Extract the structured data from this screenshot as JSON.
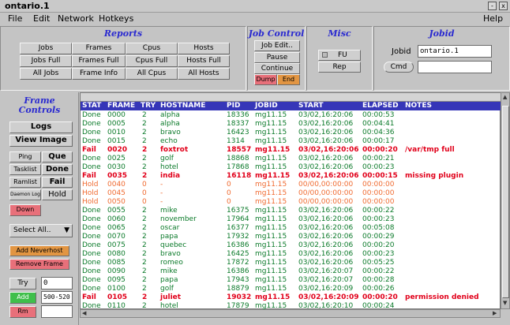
{
  "window": {
    "title": "ontario.1",
    "minimize_glyph": "-",
    "close_glyph": "x"
  },
  "menu": {
    "file": "File",
    "edit": "Edit",
    "network": "Network",
    "hotkeys": "Hotkeys",
    "help": "Help"
  },
  "reports": {
    "title": "Reports",
    "buttons": [
      "Jobs",
      "Frames",
      "Cpus",
      "Hosts",
      "Jobs Full",
      "Frames Full",
      "Cpus Full",
      "Hosts Full",
      "All Jobs",
      "Frame Info",
      "All Cpus",
      "All Hosts"
    ]
  },
  "job_control": {
    "title": "Job Control",
    "job_edit": "Job Edit..",
    "pause": "Pause",
    "continue": "Continue",
    "dump": "Dump",
    "end": "End"
  },
  "misc": {
    "title": "Misc",
    "fu": "FU",
    "rep": "Rep"
  },
  "jobid": {
    "title": "Jobid",
    "label": "Jobid",
    "value": "ontario.1",
    "cmd": "Cmd",
    "cmd_value": ""
  },
  "frame_controls": {
    "title_line1": "Frame",
    "title_line2": "Controls",
    "logs": "Logs",
    "view_image": "View Image",
    "ping": "Ping",
    "que": "Que",
    "tasklist": "Tasklist",
    "done": "Done",
    "ramlist": "Ramlist",
    "fail": "Fail",
    "daemon_log": "Daemon Log",
    "hold": "Hold",
    "down": "Down",
    "select": "Select All..",
    "add_neverhost": "Add Neverhost",
    "remove_frame": "Remove Frame",
    "try": "Try",
    "try_value": "0",
    "add": "Add",
    "add_value": "500-520",
    "rm": "Rm",
    "rm_value": ""
  },
  "table": {
    "columns": [
      "STAT",
      "FRAME",
      "TRY",
      "HOSTNAME",
      "PID",
      "JOBID",
      "START",
      "ELAPSED",
      "NOTES"
    ],
    "rows": [
      {
        "stat": "Done",
        "frame": "0000",
        "try": "2",
        "host": "alpha",
        "pid": "18336",
        "jobid": "mg11.15",
        "start": "03/02,16:20:06",
        "elapsed": "00:00:53",
        "notes": ""
      },
      {
        "stat": "Done",
        "frame": "0005",
        "try": "2",
        "host": "alpha",
        "pid": "18337",
        "jobid": "mg11.15",
        "start": "03/02,16:20:06",
        "elapsed": "00:04:41",
        "notes": ""
      },
      {
        "stat": "Done",
        "frame": "0010",
        "try": "2",
        "host": "bravo",
        "pid": "16423",
        "jobid": "mg11.15",
        "start": "03/02,16:20:06",
        "elapsed": "00:04:36",
        "notes": ""
      },
      {
        "stat": "Done",
        "frame": "0015",
        "try": "2",
        "host": "echo",
        "pid": "1314",
        "jobid": "mg11.15",
        "start": "03/02,16:20:06",
        "elapsed": "00:00:17",
        "notes": ""
      },
      {
        "stat": "Fail",
        "frame": "0020",
        "try": "2",
        "host": "foxtrot",
        "pid": "18557",
        "jobid": "mg11.15",
        "start": "03/02,16:20:06",
        "elapsed": "00:00:20",
        "notes": "/var/tmp full"
      },
      {
        "stat": "Done",
        "frame": "0025",
        "try": "2",
        "host": "golf",
        "pid": "18868",
        "jobid": "mg11.15",
        "start": "03/02,16:20:06",
        "elapsed": "00:00:21",
        "notes": ""
      },
      {
        "stat": "Done",
        "frame": "0030",
        "try": "2",
        "host": "hotel",
        "pid": "17868",
        "jobid": "mg11.15",
        "start": "03/02,16:20:06",
        "elapsed": "00:00:23",
        "notes": ""
      },
      {
        "stat": "Fail",
        "frame": "0035",
        "try": "2",
        "host": "india",
        "pid": "16118",
        "jobid": "mg11.15",
        "start": "03/02,16:20:06",
        "elapsed": "00:00:15",
        "notes": "missing plugin"
      },
      {
        "stat": "Hold",
        "frame": "0040",
        "try": "0",
        "host": "-",
        "pid": "0",
        "jobid": "mg11.15",
        "start": "00/00,00:00:00",
        "elapsed": "00:00:00",
        "notes": ""
      },
      {
        "stat": "Hold",
        "frame": "0045",
        "try": "0",
        "host": "-",
        "pid": "0",
        "jobid": "mg11.15",
        "start": "00/00,00:00:00",
        "elapsed": "00:00:00",
        "notes": ""
      },
      {
        "stat": "Hold",
        "frame": "0050",
        "try": "0",
        "host": "-",
        "pid": "0",
        "jobid": "mg11.15",
        "start": "00/00,00:00:00",
        "elapsed": "00:00:00",
        "notes": ""
      },
      {
        "stat": "Done",
        "frame": "0055",
        "try": "2",
        "host": "mike",
        "pid": "16375",
        "jobid": "mg11.15",
        "start": "03/02,16:20:06",
        "elapsed": "00:00:22",
        "notes": ""
      },
      {
        "stat": "Done",
        "frame": "0060",
        "try": "2",
        "host": "november",
        "pid": "17964",
        "jobid": "mg11.15",
        "start": "03/02,16:20:06",
        "elapsed": "00:00:23",
        "notes": ""
      },
      {
        "stat": "Done",
        "frame": "0065",
        "try": "2",
        "host": "oscar",
        "pid": "16377",
        "jobid": "mg11.15",
        "start": "03/02,16:20:06",
        "elapsed": "00:05:08",
        "notes": ""
      },
      {
        "stat": "Done",
        "frame": "0070",
        "try": "2",
        "host": "papa",
        "pid": "17932",
        "jobid": "mg11.15",
        "start": "03/02,16:20:06",
        "elapsed": "00:00:29",
        "notes": ""
      },
      {
        "stat": "Done",
        "frame": "0075",
        "try": "2",
        "host": "quebec",
        "pid": "16386",
        "jobid": "mg11.15",
        "start": "03/02,16:20:06",
        "elapsed": "00:00:20",
        "notes": ""
      },
      {
        "stat": "Done",
        "frame": "0080",
        "try": "2",
        "host": "bravo",
        "pid": "16425",
        "jobid": "mg11.15",
        "start": "03/02,16:20:06",
        "elapsed": "00:00:23",
        "notes": ""
      },
      {
        "stat": "Done",
        "frame": "0085",
        "try": "2",
        "host": "romeo",
        "pid": "17872",
        "jobid": "mg11.15",
        "start": "03/02,16:20:06",
        "elapsed": "00:05:25",
        "notes": ""
      },
      {
        "stat": "Done",
        "frame": "0090",
        "try": "2",
        "host": "mike",
        "pid": "16386",
        "jobid": "mg11.15",
        "start": "03/02,16:20:07",
        "elapsed": "00:00:22",
        "notes": ""
      },
      {
        "stat": "Done",
        "frame": "0095",
        "try": "2",
        "host": "papa",
        "pid": "17943",
        "jobid": "mg11.15",
        "start": "03/02,16:20:07",
        "elapsed": "00:00:28",
        "notes": ""
      },
      {
        "stat": "Done",
        "frame": "0100",
        "try": "2",
        "host": "golf",
        "pid": "18879",
        "jobid": "mg11.15",
        "start": "03/02,16:20:09",
        "elapsed": "00:00:26",
        "notes": ""
      },
      {
        "stat": "Fail",
        "frame": "0105",
        "try": "2",
        "host": "juliet",
        "pid": "19032",
        "jobid": "mg11.15",
        "start": "03/02,16:20:09",
        "elapsed": "00:00:20",
        "notes": "permission denied"
      },
      {
        "stat": "Done",
        "frame": "0110",
        "try": "2",
        "host": "hotel",
        "pid": "17879",
        "jobid": "mg11.15",
        "start": "03/02,16:20:10",
        "elapsed": "00:00:24",
        "notes": ""
      }
    ]
  },
  "colors": {
    "header_bg": "#3636b8",
    "done": "#0b7a2a",
    "fail": "#e1001a",
    "hold": "#f06a30",
    "section_title": "#2a2ad0"
  }
}
